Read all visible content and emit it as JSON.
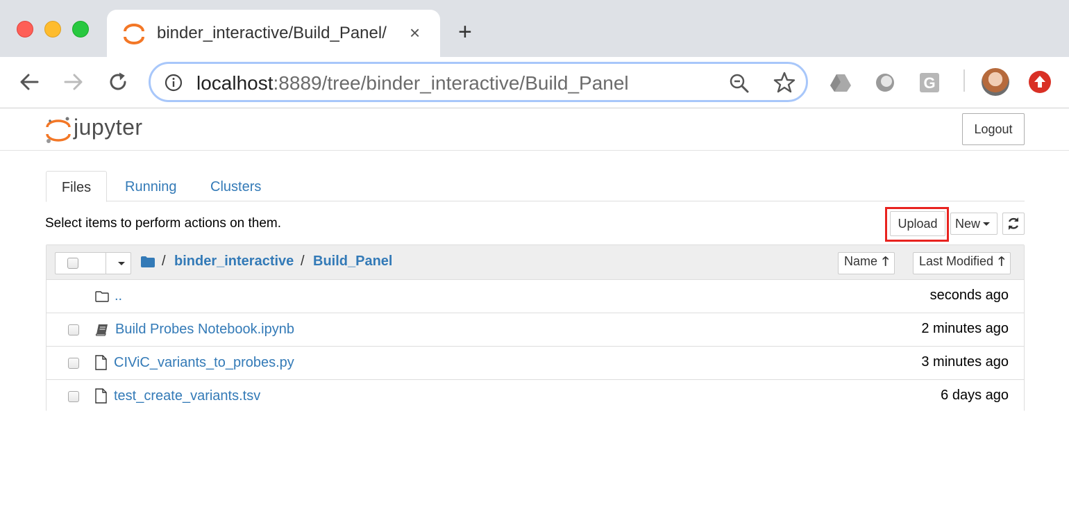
{
  "browser": {
    "tab_title": "binder_interactive/Build_Panel/",
    "tab_close": "×",
    "new_tab": "+",
    "url_host": "localhost",
    "url_rest": ":8889/tree/binder_interactive/Build_Panel"
  },
  "jupyter": {
    "logo_text": "jupyter",
    "logout_label": "Logout",
    "tabs": [
      {
        "label": "Files",
        "active": true
      },
      {
        "label": "Running",
        "active": false
      },
      {
        "label": "Clusters",
        "active": false
      }
    ],
    "hint": "Select items to perform actions on them.",
    "upload_label": "Upload",
    "new_label": "New",
    "breadcrumb": {
      "separator": "/",
      "items": [
        "binder_interactive",
        "Build_Panel"
      ]
    },
    "sort": {
      "name_label": "Name",
      "modified_label": "Last Modified",
      "arrow": "🡑"
    },
    "files": [
      {
        "name": "..",
        "icon": "folder-icon",
        "modified": "seconds ago"
      },
      {
        "name": "Build Probes Notebook.ipynb",
        "icon": "notebook-icon",
        "modified": "2 minutes ago"
      },
      {
        "name": "CIViC_variants_to_probes.py",
        "icon": "file-icon",
        "modified": "3 minutes ago"
      },
      {
        "name": "test_create_variants.tsv",
        "icon": "file-icon",
        "modified": "6 days ago"
      }
    ]
  },
  "colors": {
    "link": "#337ab7",
    "highlight": "#e8231f",
    "jupyter_orange": "#f37726"
  }
}
